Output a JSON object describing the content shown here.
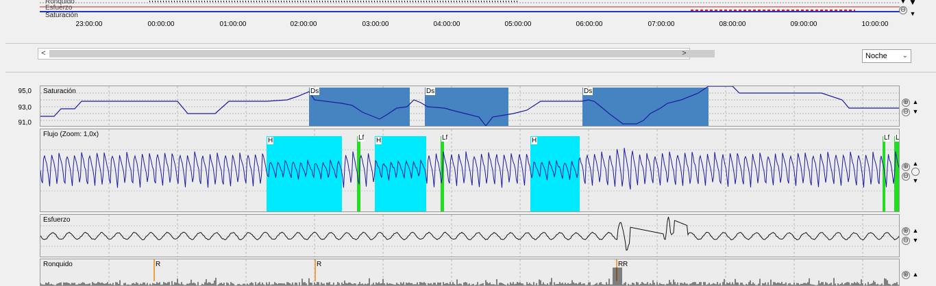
{
  "top_strip": {
    "labels": [
      "Ronquido",
      "Esfuerzo",
      "Saturación"
    ],
    "times": [
      "23:00:00",
      "00:00:00",
      "01:00:00",
      "02:00:00",
      "03:00:00",
      "04:00:00",
      "05:00:00",
      "06:00:00",
      "07:00:00",
      "08:00:00",
      "09:00:00",
      "10:00:00"
    ]
  },
  "scrollbar": {
    "left_arrow": "<",
    "right_arrow": ">"
  },
  "view_select": {
    "value": "Noche",
    "chevron": "⌄"
  },
  "panels": {
    "saturacion": {
      "title": "Saturación",
      "y_labels": [
        "95,0",
        "93,0",
        "91,0"
      ],
      "events": [
        "Ds",
        "Ds",
        "Ds"
      ]
    },
    "flujo": {
      "title": "Flujo (Zoom: 1,0x)",
      "events": [
        "H",
        "Lf",
        "H",
        "Lf",
        "H",
        "Lf",
        "L"
      ]
    },
    "esfuerzo": {
      "title": "Esfuerzo"
    },
    "ronquido": {
      "title": "Ronquido",
      "events": [
        "R",
        "R",
        "R",
        "R"
      ]
    }
  },
  "controls": {
    "zoom_in": "⊕",
    "zoom_out": "⊖",
    "up": "▲",
    "down": "▼"
  },
  "colors": {
    "signal_blue": "#1a1aa0",
    "desat_fill": "#3d7ebf",
    "hypopnea_fill": "#00eaff",
    "flow_limit": "#22dd22",
    "snore_marker": "#f0a040"
  }
}
